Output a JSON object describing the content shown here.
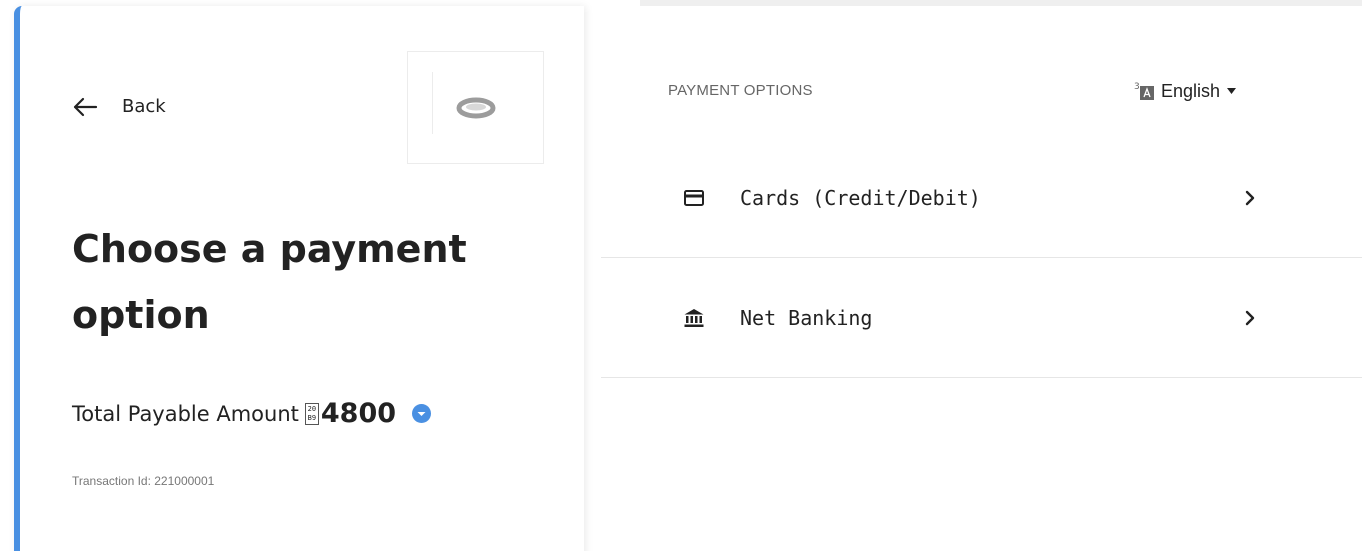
{
  "header": {
    "back_label": "Back",
    "logo_icon": "ring-logo-icon"
  },
  "summary": {
    "heading": "Choose a payment option",
    "amount_label": "Total Payable Amount",
    "currency_glyph_top": "20",
    "currency_glyph_bottom": "B9",
    "amount": "4800",
    "transaction": "Transaction Id: 221000001",
    "accent_color": "#4a90e2"
  },
  "payment": {
    "title": "PAYMENT OPTIONS",
    "language": "English",
    "options": [
      {
        "label": "Cards (Credit/Debit)",
        "icon": "credit-card-icon"
      },
      {
        "label": "Net Banking",
        "icon": "bank-icon"
      }
    ]
  }
}
